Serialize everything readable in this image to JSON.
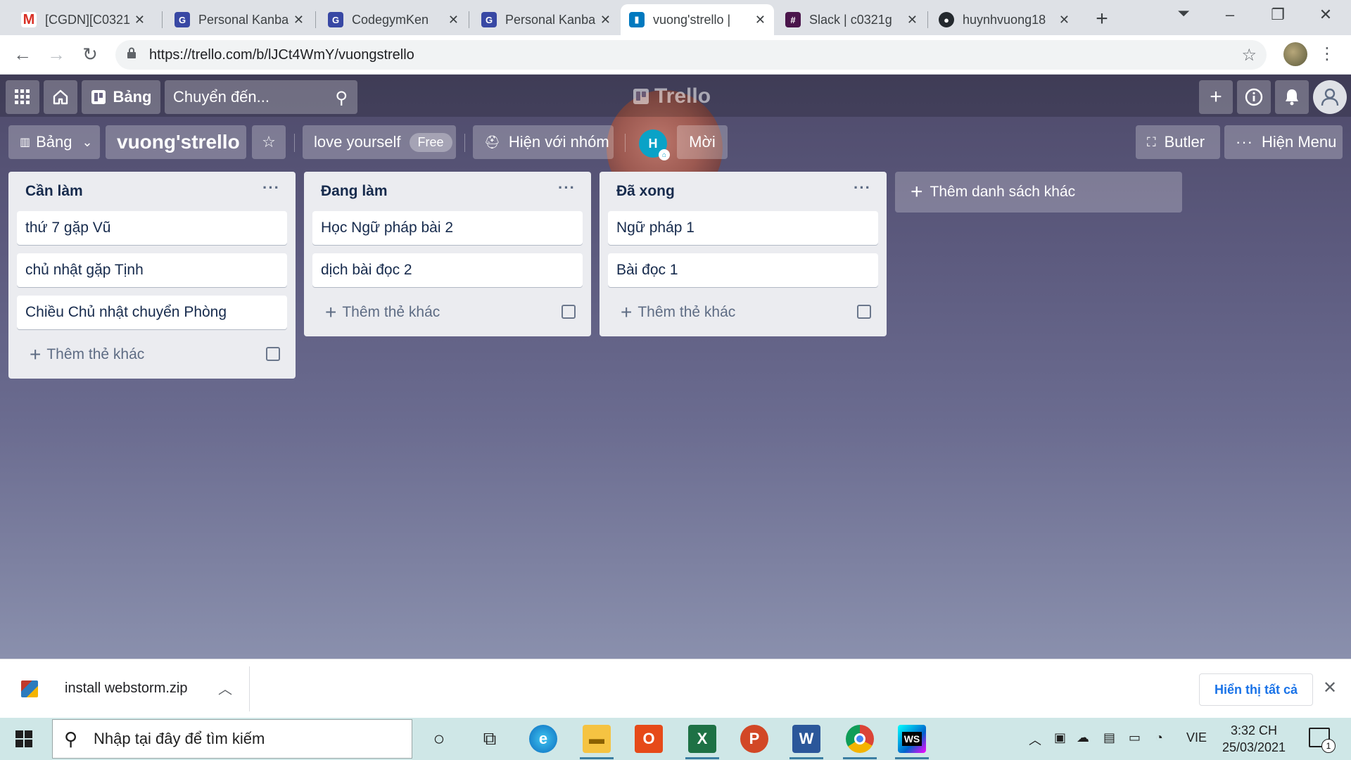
{
  "browser": {
    "tabs": [
      {
        "title": "[CGDN][C0321",
        "favicon": "gmail-icon",
        "active": false
      },
      {
        "title": "Personal Kanba",
        "favicon": "codegym-icon",
        "active": false
      },
      {
        "title": "CodegymKen",
        "favicon": "codegym-icon",
        "active": false
      },
      {
        "title": "Personal Kanba",
        "favicon": "codegym-icon",
        "active": false
      },
      {
        "title": "vuong'strello |",
        "favicon": "trello-icon",
        "active": true
      },
      {
        "title": "Slack | c0321g",
        "favicon": "slack-icon",
        "active": false
      },
      {
        "title": "huynhvuong18",
        "favicon": "github-icon",
        "active": false
      }
    ],
    "url": "https://trello.com/b/lJCt4WmY/vuongstrello"
  },
  "trello": {
    "header": {
      "boards_label": "Bảng",
      "search_placeholder": "Chuyển đến...",
      "logo": "Trello"
    },
    "board_bar": {
      "view_label": "Bảng",
      "board_title": "vuong'strello",
      "team_name": "love yourself",
      "plan_badge": "Free",
      "visibility_label": "Hiện với nhóm",
      "member_initial": "H",
      "invite_label": "Mời",
      "butler_label": "Butler",
      "menu_label": "Hiện Menu"
    },
    "lists": [
      {
        "title": "Cần làm",
        "cards": [
          "thứ 7 gặp Vũ",
          "chủ nhật gặp Tịnh",
          "Chiều Chủ nhật chuyển Phòng"
        ],
        "add_card_label": "Thêm thẻ khác"
      },
      {
        "title": "Đang làm",
        "cards": [
          "Học Ngữ pháp bài 2",
          "dịch bài đọc 2"
        ],
        "add_card_label": "Thêm thẻ khác"
      },
      {
        "title": "Đã xong",
        "cards": [
          "Ngữ pháp 1",
          "Bài đọc 1"
        ],
        "add_card_label": "Thêm thẻ khác"
      }
    ],
    "add_list_label": "Thêm danh sách khác"
  },
  "download_bar": {
    "file_name": "install webstorm.zip",
    "show_all": "Hiển thị tất cả"
  },
  "taskbar": {
    "search_placeholder": "Nhập tại đây để tìm kiếm",
    "language": "VIE",
    "time": "3:32 CH",
    "date": "25/03/2021",
    "notification_count": "1"
  }
}
